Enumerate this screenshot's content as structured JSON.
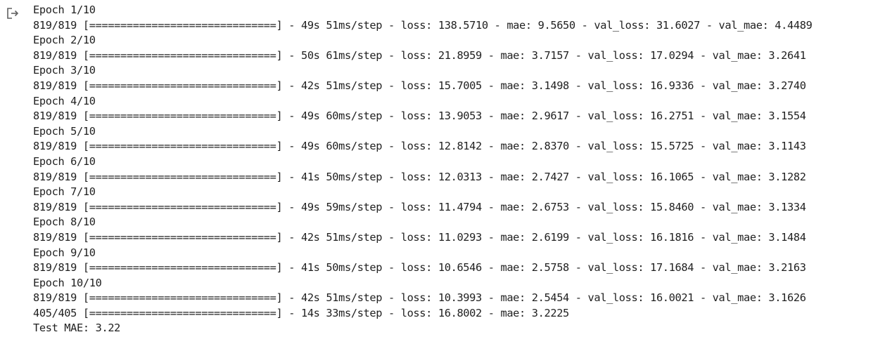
{
  "output": {
    "lines": [
      "Epoch 1/10",
      "819/819 [==============================] - 49s 51ms/step - loss: 138.5710 - mae: 9.5650 - val_loss: 31.6027 - val_mae: 4.4489",
      "Epoch 2/10",
      "819/819 [==============================] - 50s 61ms/step - loss: 21.8959 - mae: 3.7157 - val_loss: 17.0294 - val_mae: 3.2641",
      "Epoch 3/10",
      "819/819 [==============================] - 42s 51ms/step - loss: 15.7005 - mae: 3.1498 - val_loss: 16.9336 - val_mae: 3.2740",
      "Epoch 4/10",
      "819/819 [==============================] - 49s 60ms/step - loss: 13.9053 - mae: 2.9617 - val_loss: 16.2751 - val_mae: 3.1554",
      "Epoch 5/10",
      "819/819 [==============================] - 49s 60ms/step - loss: 12.8142 - mae: 2.8370 - val_loss: 15.5725 - val_mae: 3.1143",
      "Epoch 6/10",
      "819/819 [==============================] - 41s 50ms/step - loss: 12.0313 - mae: 2.7427 - val_loss: 16.1065 - val_mae: 3.1282",
      "Epoch 7/10",
      "819/819 [==============================] - 49s 59ms/step - loss: 11.4794 - mae: 2.6753 - val_loss: 15.8460 - val_mae: 3.1334",
      "Epoch 8/10",
      "819/819 [==============================] - 42s 51ms/step - loss: 11.0293 - mae: 2.6199 - val_loss: 16.1816 - val_mae: 3.1484",
      "Epoch 9/10",
      "819/819 [==============================] - 41s 50ms/step - loss: 10.6546 - mae: 2.5758 - val_loss: 17.1684 - val_mae: 3.2163",
      "Epoch 10/10",
      "819/819 [==============================] - 42s 51ms/step - loss: 10.3993 - mae: 2.5454 - val_loss: 16.0021 - val_mae: 3.1626",
      "405/405 [==============================] - 14s 33ms/step - loss: 16.8002 - mae: 3.2225",
      "Test MAE: 3.22"
    ]
  },
  "icons": {
    "output_icon": "output-redirect-icon"
  },
  "colors": {
    "text": "#212121",
    "icon": "#616161",
    "background": "#ffffff"
  }
}
